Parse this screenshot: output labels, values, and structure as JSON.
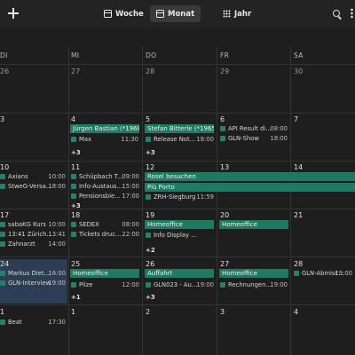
{
  "toolbar": {
    "views": [
      {
        "label": "Woche",
        "icon": "calendar-icon"
      },
      {
        "label": "Monat",
        "icon": "calendar-icon",
        "active": true
      },
      {
        "label": "Jahr",
        "icon": "grid-icon"
      }
    ]
  },
  "weekdays": [
    "DI",
    "MI",
    "DO",
    "FR",
    "SA"
  ],
  "weeks": [
    {
      "days": [
        "26",
        "27",
        "28",
        "29",
        "30"
      ]
    },
    {
      "days": [
        "3",
        "4",
        "5",
        "6",
        "7"
      ]
    },
    {
      "days": [
        "10",
        "11",
        "12",
        "13",
        "14"
      ]
    },
    {
      "days": [
        "17",
        "18",
        "19",
        "20",
        "21"
      ]
    },
    {
      "days": [
        "24",
        "25",
        "26",
        "27",
        "28"
      ]
    },
    {
      "days": [
        "1",
        "1",
        "2",
        "3",
        "4"
      ]
    }
  ],
  "bars": {
    "jurgen": "Jürgen Bastian (*1968)",
    "stefan": "Stefan Bitterle (*1965)",
    "rosel": "Rosel besuchen",
    "piu": "Più Porto",
    "home18": "Homeoffice",
    "home20": "Homeoffice",
    "home25": "Homeoffice",
    "auffahrt": "Auffahrt",
    "home27": "Homeoffice"
  },
  "events": {
    "max": {
      "title": "Max",
      "time": "11:30"
    },
    "release": {
      "title": "Release Not...",
      "time": "18:00"
    },
    "api": {
      "title": "API Result di...",
      "time": "08:00"
    },
    "gln_show": {
      "title": "GLN-Show",
      "time": "18:00"
    },
    "axians": {
      "title": "Axians",
      "time": "10:00"
    },
    "stweg": {
      "title": "StweG-Versa...",
      "time": "18:00"
    },
    "schupbach": {
      "title": "Schüpbach T...",
      "time": "09:00"
    },
    "info_aust": {
      "title": "Info-Austaus...",
      "time": "15:00"
    },
    "pension": {
      "title": "Pensionsbie...",
      "time": "17:00"
    },
    "zrh": {
      "title": "ZRH-Siegburg",
      "time": "11:59"
    },
    "saba": {
      "title": "sabaKG Kurs",
      "time": "10:00"
    },
    "zurich": {
      "title": "13:41 Zürich...",
      "time": "13:41"
    },
    "zahnarzt": {
      "title": "Zahnarzt",
      "time": "14:00"
    },
    "sedex": {
      "title": "SEDEX",
      "time": "08:00"
    },
    "tickets": {
      "title": "Tickets druc...",
      "time": "22:00"
    },
    "info_display": {
      "title": "Info Display ...",
      "time": ""
    },
    "markus": {
      "title": "Markus Diet...",
      "time": "16:00"
    },
    "gln_interview": {
      "title": "GLN-Interview",
      "time": "19:00"
    },
    "pilze": {
      "title": "Pilze",
      "time": "12:00"
    },
    "gln023": {
      "title": "GLN023 - Au...",
      "time": "19:00"
    },
    "rechnungen": {
      "title": "Rechnungen...",
      "time": "19:00"
    },
    "gln_abmisc": {
      "title": "GLN-Abmisc...",
      "time": "19:00"
    },
    "beat": {
      "title": "Beat",
      "time": "17:30"
    }
  },
  "more": {
    "w2_mi": "+3",
    "w2_do": "+3",
    "w3_mi": "+3",
    "w4_do": "+2",
    "w5_mi": "+1",
    "w5_do": "+3"
  },
  "colors": {
    "event": "#1f7a64",
    "today": "#2c3e54",
    "background": "#1e1e1e"
  }
}
